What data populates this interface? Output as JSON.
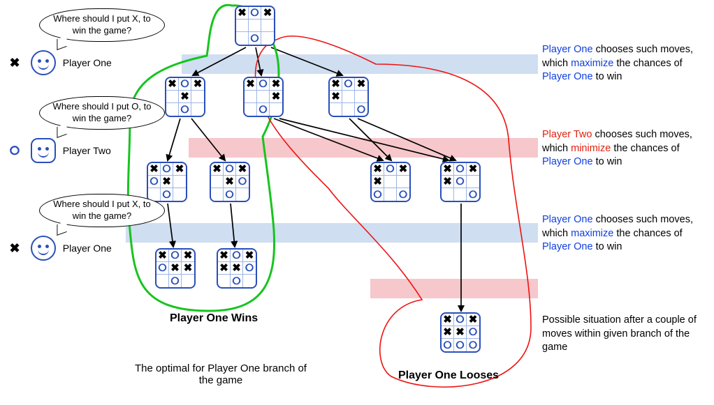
{
  "players": {
    "one": {
      "label": "Player One",
      "symbol": "✖",
      "question": "Where should I put X, to win the game?"
    },
    "two": {
      "label": "Player Two",
      "symbol": "⭘",
      "question": "Where should I put O, to win the game?"
    }
  },
  "explain": {
    "level1": {
      "parts": [
        "Player One",
        " chooses such moves, which ",
        "maximize",
        " the chances of ",
        "Player One",
        " to win"
      ]
    },
    "level2": {
      "parts": [
        "Player Two",
        " chooses such moves, which ",
        "minimize",
        " the chances of ",
        "Player One",
        " to win"
      ]
    },
    "level3": {
      "parts": [
        "Player One",
        " chooses such moves, which ",
        "maximize",
        " the chances of ",
        "Player One",
        " to win"
      ]
    },
    "outcome": "Possible situation after a couple of moves within given branch of the game"
  },
  "captions": {
    "win": "Player One Wins",
    "lose": "Player One Looses",
    "optimal": "The optimal for Player One branch of the game"
  },
  "boards": {
    "mark_legend": "X=black-X, O=blue-O, x=red-X, o=red-O, .=empty",
    "root": "XOX....O.",
    "l1_a": "XOX.X..O.",
    "l1_b": "XOX..X.O.",
    "l1_c": "XOXX....O",
    "l2_a": "XOXOX..O.",
    "l2_b": "XOX.XO.O.",
    "l2_c": "XOXX..O.O",
    "l2_d": "XOXXO...O",
    "l3_a": "XOXOXX.O.",
    "l3_b": "XOXXXO.O.",
    "final": "XOXXXOOOO"
  },
  "chart_data": {
    "type": "tree",
    "note": "Minimax game tree for tic-tac-toe. Player One = X (max), Player Two = O (min). Highlighted cells (lowercase) are the most-recent move at that ply.",
    "symbols": {
      "X": "X black (existing)",
      "O": "O blue (existing)",
      "x": "red X (new this ply)",
      "o": "red O (new this ply)",
      ".": "empty"
    },
    "nodes": [
      {
        "id": "root",
        "ply": 0,
        "turn": "X",
        "state": [
          "X",
          "O",
          "X",
          ".",
          ".",
          ".",
          ".",
          "O",
          "."
        ]
      },
      {
        "id": "l1_a",
        "ply": 1,
        "turn": "O",
        "state": [
          "X",
          "O",
          "X",
          ".",
          "x",
          ".",
          ".",
          "O",
          "."
        ]
      },
      {
        "id": "l1_b",
        "ply": 1,
        "turn": "O",
        "state": [
          "X",
          "O",
          "X",
          ".",
          ".",
          "x",
          ".",
          "O",
          "."
        ]
      },
      {
        "id": "l1_c",
        "ply": 1,
        "turn": "O",
        "state": [
          "X",
          "O",
          "X",
          "x",
          ".",
          ".",
          ".",
          ".",
          "O"
        ]
      },
      {
        "id": "l2_a",
        "ply": 2,
        "turn": "X",
        "state": [
          "X",
          "O",
          "X",
          "o",
          "X",
          ".",
          ".",
          "O",
          "."
        ]
      },
      {
        "id": "l2_b",
        "ply": 2,
        "turn": "X",
        "state": [
          "X",
          "O",
          "X",
          ".",
          "X",
          "o",
          ".",
          "O",
          "."
        ]
      },
      {
        "id": "l2_c",
        "ply": 2,
        "turn": "X",
        "state": [
          "X",
          "O",
          "X",
          "X",
          ".",
          ".",
          "o",
          ".",
          "O"
        ]
      },
      {
        "id": "l2_d",
        "ply": 2,
        "turn": "X",
        "state": [
          "X",
          "O",
          "X",
          "X",
          "o",
          ".",
          ".",
          ".",
          "O"
        ]
      },
      {
        "id": "l3_a",
        "ply": 3,
        "turn": "-",
        "state": [
          "X",
          "O",
          "X",
          "O",
          "x",
          "X",
          ".",
          "O",
          "."
        ],
        "result": "Player One Wins"
      },
      {
        "id": "l3_b",
        "ply": 3,
        "turn": "-",
        "state": [
          "X",
          "O",
          "X",
          "x",
          "X",
          "O",
          ".",
          "O",
          "."
        ],
        "result": "Player One Wins"
      },
      {
        "id": "final",
        "ply": 5,
        "turn": "-",
        "state": [
          "X",
          "O",
          "X",
          "X",
          "X",
          "O",
          "O",
          "O",
          "O"
        ],
        "result": "Player One Looses"
      }
    ],
    "edges": [
      [
        "root",
        "l1_a"
      ],
      [
        "root",
        "l1_b"
      ],
      [
        "root",
        "l1_c"
      ],
      [
        "l1_a",
        "l2_a"
      ],
      [
        "l1_a",
        "l2_b"
      ],
      [
        "l1_b",
        "l2_c"
      ],
      [
        "l1_b",
        "l2_d"
      ],
      [
        "l1_c",
        "l2_c"
      ],
      [
        "l1_c",
        "l2_d"
      ],
      [
        "l2_a",
        "l3_a"
      ],
      [
        "l2_b",
        "l3_b"
      ],
      [
        "l2_d",
        "final"
      ]
    ],
    "outlined_branches": {
      "optimal_green": [
        "root",
        "l1_a",
        "l2_a",
        "l2_b",
        "l3_a",
        "l3_b"
      ],
      "losing_red": [
        "root",
        "l1_c",
        "l2_c",
        "l2_d",
        "final"
      ]
    }
  }
}
